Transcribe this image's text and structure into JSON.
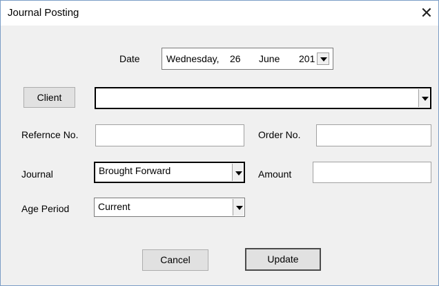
{
  "window": {
    "title": "Journal Posting",
    "close_glyph": "✕"
  },
  "date": {
    "label": "Date",
    "weekday": "Wednesday,",
    "day": "26",
    "month": "June",
    "year": "201"
  },
  "client": {
    "button_label": "Client",
    "value": ""
  },
  "reference": {
    "label": "Refernce No.",
    "value": ""
  },
  "order": {
    "label": "Order No.",
    "value": ""
  },
  "journal": {
    "label": "Journal",
    "value": "Brought Forward"
  },
  "amount": {
    "label": "Amount",
    "value": ""
  },
  "age_period": {
    "label": "Age Period",
    "value": "Current"
  },
  "buttons": {
    "cancel": "Cancel",
    "update": "Update"
  }
}
